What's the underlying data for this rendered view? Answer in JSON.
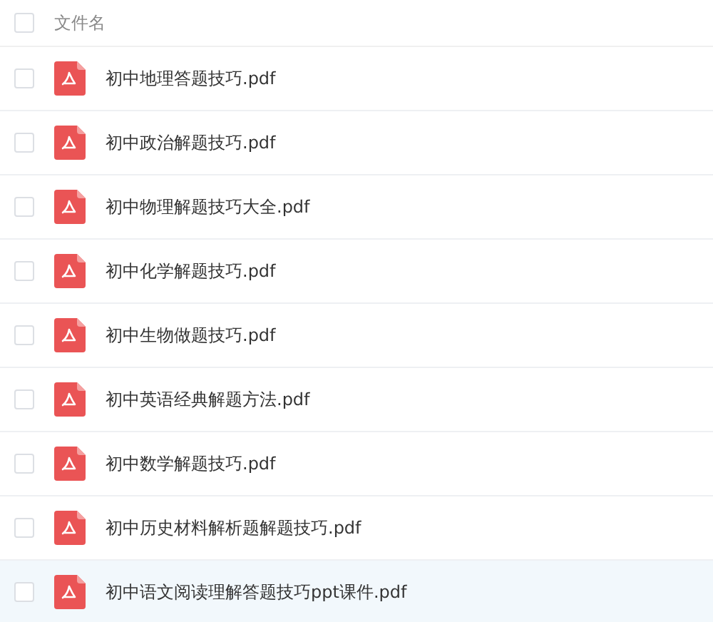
{
  "header": {
    "checked": false,
    "label": "文件名"
  },
  "files": [
    {
      "name": "初中地理答题技巧.pdf",
      "checked": false,
      "selected": false
    },
    {
      "name": "初中政治解题技巧.pdf",
      "checked": false,
      "selected": false
    },
    {
      "name": "初中物理解题技巧大全.pdf",
      "checked": false,
      "selected": false
    },
    {
      "name": "初中化学解题技巧.pdf",
      "checked": false,
      "selected": false
    },
    {
      "name": "初中生物做题技巧.pdf",
      "checked": false,
      "selected": false
    },
    {
      "name": "初中英语经典解题方法.pdf",
      "checked": false,
      "selected": false
    },
    {
      "name": "初中数学解题技巧.pdf",
      "checked": false,
      "selected": false
    },
    {
      "name": "初中历史材料解析题解题技巧.pdf",
      "checked": false,
      "selected": false
    },
    {
      "name": "初中语文阅读理解答题技巧ppt课件.pdf",
      "checked": false,
      "selected": true
    }
  ]
}
